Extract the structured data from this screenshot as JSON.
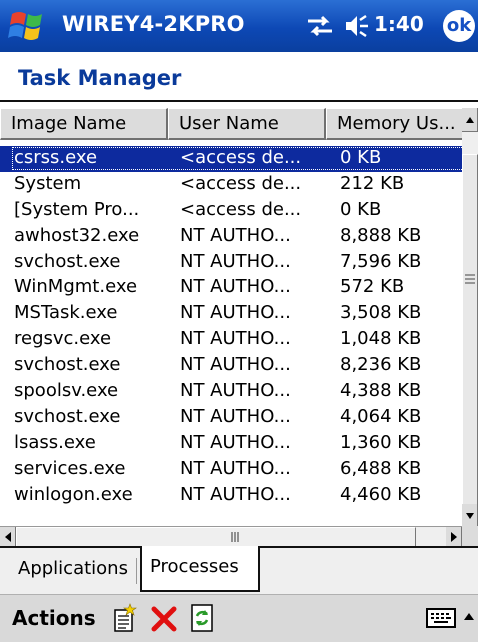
{
  "titlebar": {
    "device_name": "WIREY4-2KPRO",
    "time": "1:40",
    "ok_label": "ok"
  },
  "app": {
    "title": "Task Manager"
  },
  "listview": {
    "columns": [
      "Image Name",
      "User Name",
      "Memory Us..."
    ],
    "rows": [
      {
        "name": "csrss.exe",
        "user": "<access de...",
        "memory": "0 KB",
        "selected": true
      },
      {
        "name": "System",
        "user": "<access de...",
        "memory": "212 KB"
      },
      {
        "name": "[System Pro...",
        "user": "<access de...",
        "memory": "0 KB"
      },
      {
        "name": "awhost32.exe",
        "user": "NT AUTHO...",
        "memory": "8,888 KB"
      },
      {
        "name": "svchost.exe",
        "user": "NT AUTHO...",
        "memory": "7,596 KB"
      },
      {
        "name": "WinMgmt.exe",
        "user": "NT AUTHO...",
        "memory": "572 KB"
      },
      {
        "name": "MSTask.exe",
        "user": "NT AUTHO...",
        "memory": "3,508 KB"
      },
      {
        "name": "regsvc.exe",
        "user": "NT AUTHO...",
        "memory": "1,048 KB"
      },
      {
        "name": "svchost.exe",
        "user": "NT AUTHO...",
        "memory": "8,236 KB"
      },
      {
        "name": "spoolsv.exe",
        "user": "NT AUTHO...",
        "memory": "4,388 KB"
      },
      {
        "name": "svchost.exe",
        "user": "NT AUTHO...",
        "memory": "4,064 KB"
      },
      {
        "name": "lsass.exe",
        "user": "NT AUTHO...",
        "memory": "1,360 KB"
      },
      {
        "name": "services.exe",
        "user": "NT AUTHO...",
        "memory": "6,488 KB"
      },
      {
        "name": "winlogon.exe",
        "user": "NT AUTHO...",
        "memory": "4,460 KB"
      }
    ]
  },
  "tabs": [
    {
      "label": "Applications",
      "active": false
    },
    {
      "label": "Processes",
      "active": true
    }
  ],
  "menubar": {
    "actions_label": "Actions"
  },
  "colors": {
    "titlebar": "#0d48b5",
    "selection": "#0d2a9e",
    "app_title": "#0a3a9a",
    "delete_icon": "#e01010",
    "refresh_icon": "#2a9a2a"
  },
  "icons": {
    "start": "windows-flag-icon",
    "connectivity": "connectivity-icon",
    "volume": "speaker-icon",
    "new_task": "new-task-icon",
    "end_task": "red-x-icon",
    "refresh": "refresh-icon",
    "keyboard": "keyboard-icon"
  }
}
